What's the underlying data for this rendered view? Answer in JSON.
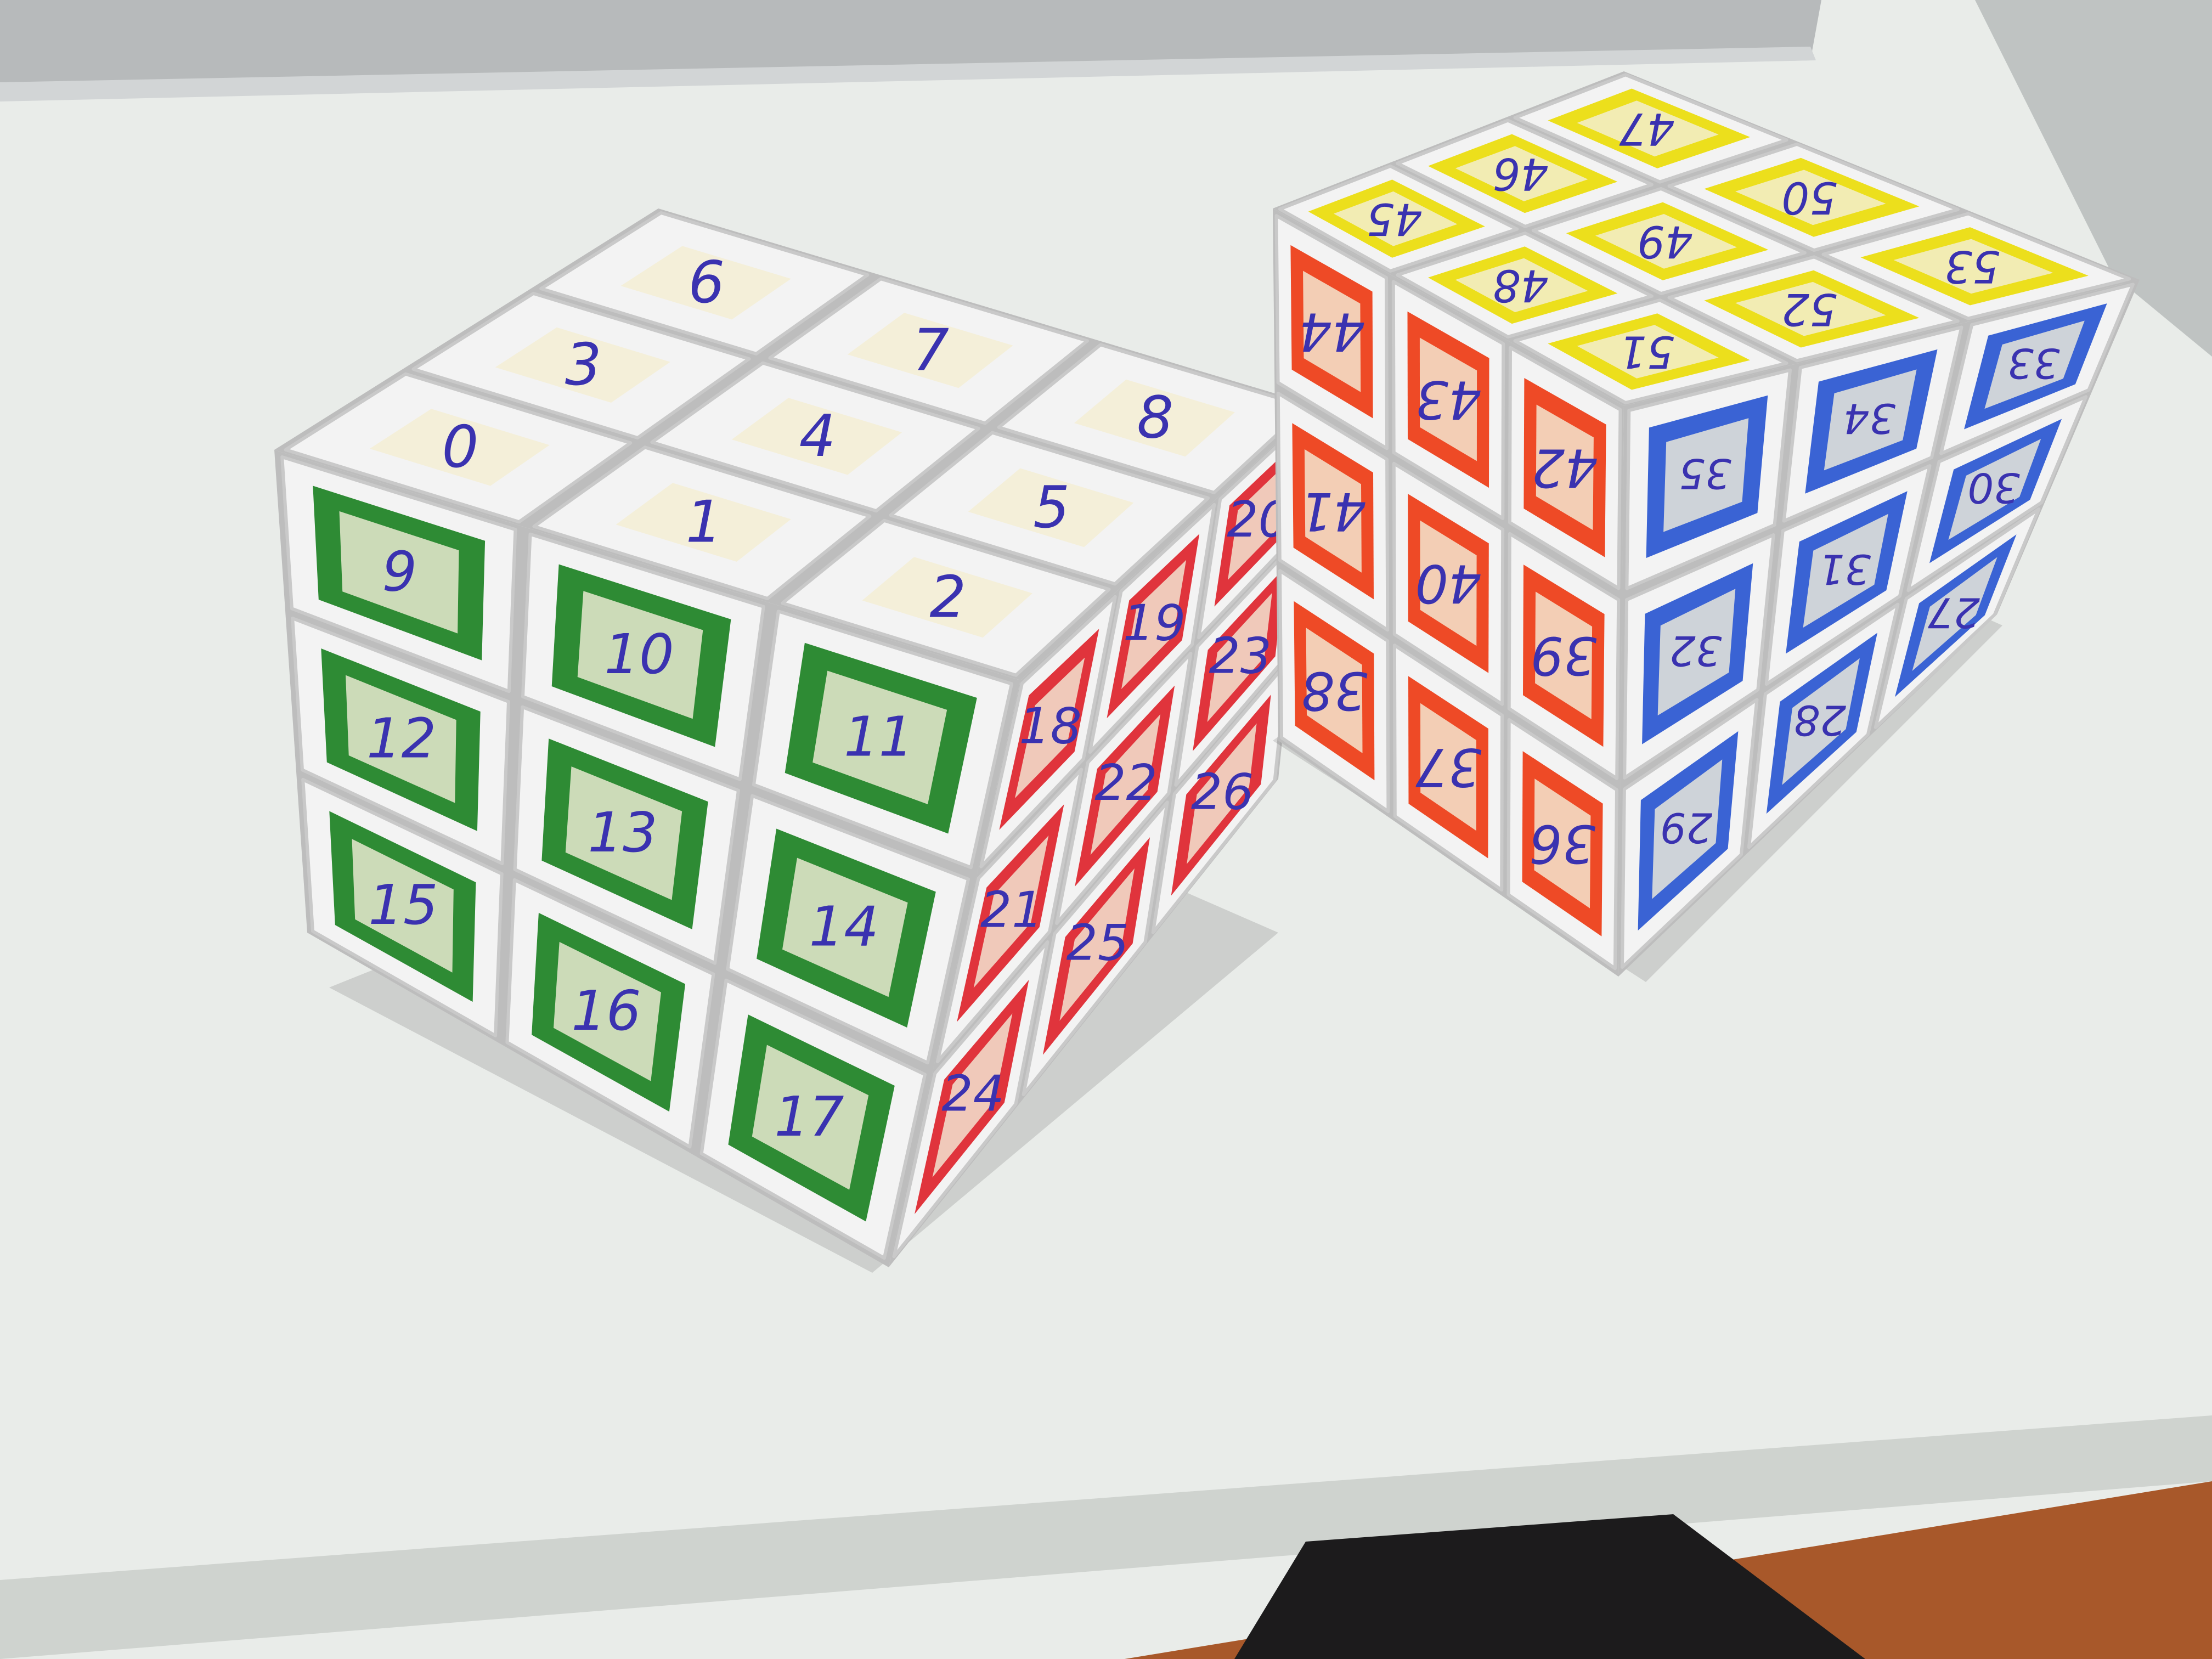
{
  "scene": {
    "colors": {
      "table": "#e9ece9",
      "laptop": "#b7babb",
      "floor": "#a8582a",
      "cube_body": "#f3f3f3",
      "paper_tape": "#f4efd9",
      "ink": "#3a32b0",
      "green": "#2e8b34",
      "red": "#e0343c",
      "orange": "#ee4a26",
      "yellow": "#ecdf1c",
      "blue": "#3a63d4"
    }
  },
  "left_cube": {
    "top_face": [
      "6",
      "7",
      "8",
      "3",
      "4",
      "5",
      "0",
      "1",
      "2"
    ],
    "front_face_green": [
      "9",
      "10",
      "11",
      "12",
      "13",
      "14",
      "15",
      "16",
      "17"
    ],
    "right_face_red": [
      "18",
      "19",
      "20",
      "21",
      "22",
      "23",
      "24",
      "25",
      "26"
    ]
  },
  "right_cube": {
    "top_face_yellow": [
      "45",
      "48",
      "51",
      "46",
      "49",
      "52",
      "47",
      "50",
      "53"
    ],
    "front_face_orange": [
      "44",
      "43",
      "42",
      "41",
      "40",
      "39",
      "38",
      "37",
      "36"
    ],
    "right_face_blue": [
      "35",
      "34",
      "33",
      "32",
      "31",
      "30",
      "29",
      "28",
      "27"
    ]
  }
}
